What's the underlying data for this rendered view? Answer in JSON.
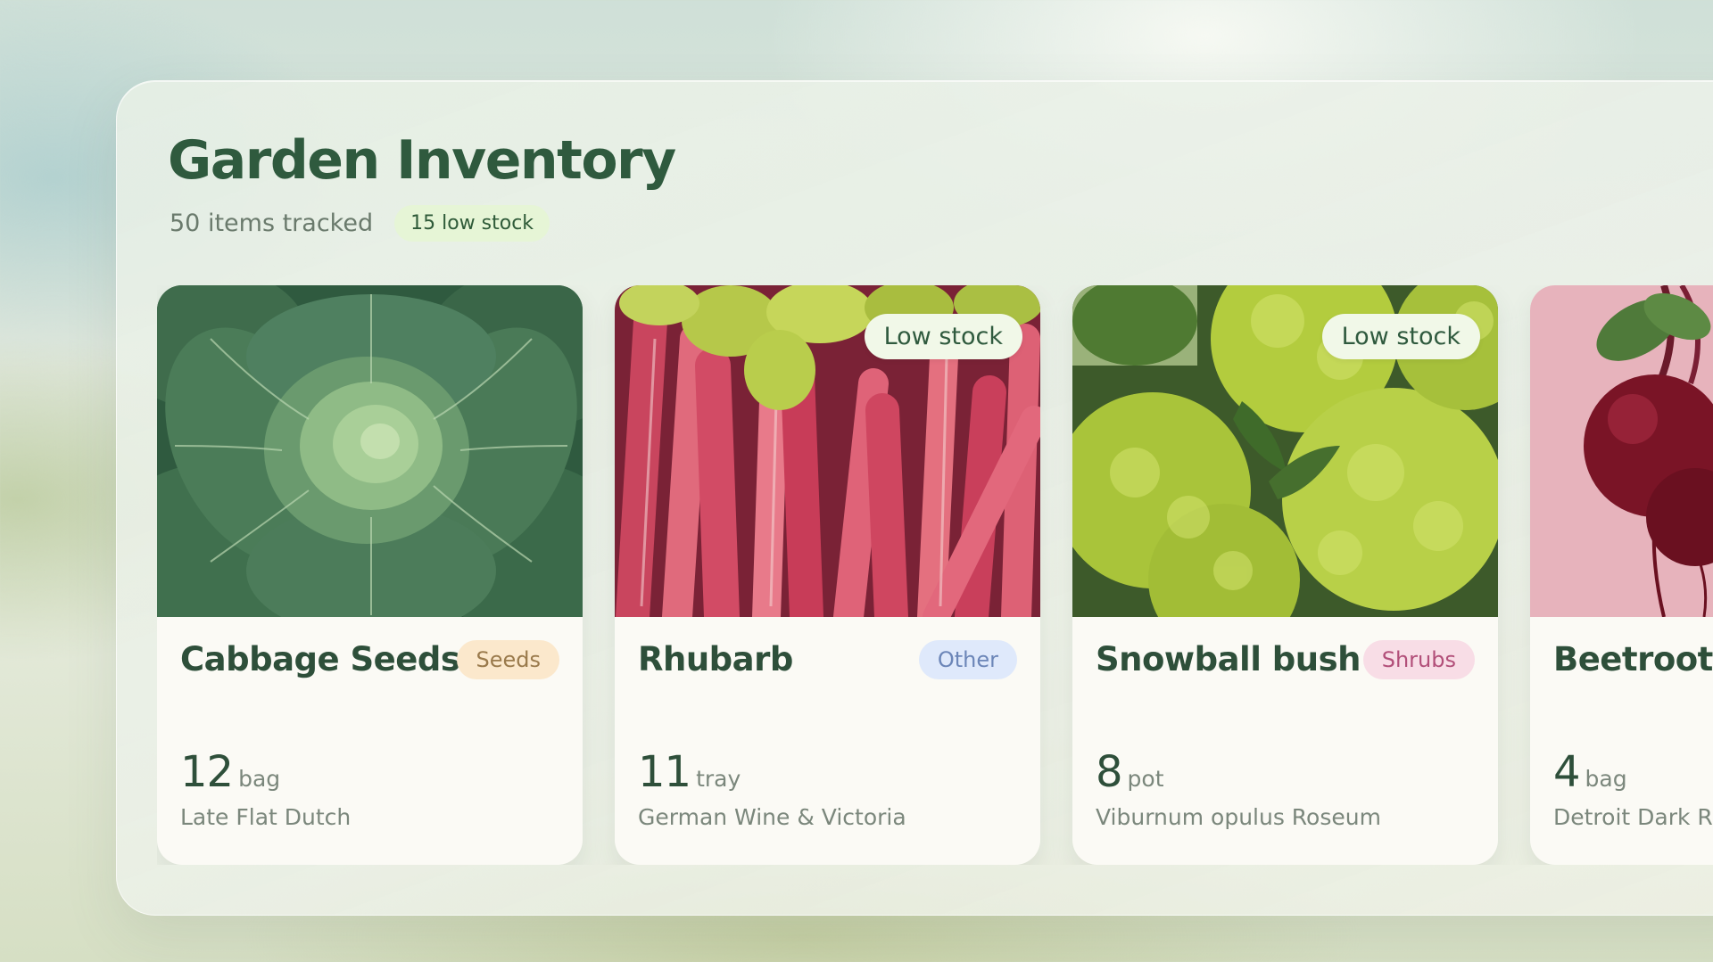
{
  "header": {
    "title": "Garden Inventory",
    "items_tracked": "50 items tracked",
    "low_stock_badge": "15 low stock"
  },
  "colors": {
    "title": "#2f5a3e",
    "low_badge_bg": "#e6f5d6",
    "card_bg": "#fbfaf5"
  },
  "cards": [
    {
      "name": "Cabbage Seeds",
      "category": "Seeds",
      "category_bg": "#fbe8cc",
      "category_fg": "#9a7a4c",
      "quantity": "12",
      "unit": "bag",
      "variety": "Late Flat Dutch",
      "stock_chip": "",
      "image": "cabbage-photo"
    },
    {
      "name": "Rhubarb",
      "category": "Other",
      "category_bg": "#dfe9fb",
      "category_fg": "#6c86b8",
      "quantity": "11",
      "unit": "tray",
      "variety": "German Wine & Victoria",
      "stock_chip": "Low stock",
      "image": "rhubarb-photo"
    },
    {
      "name": "Snowball bush",
      "category": "Shrubs",
      "category_bg": "#f8dde6",
      "category_fg": "#b24f79",
      "quantity": "8",
      "unit": "pot",
      "variety": "Viburnum opulus Roseum",
      "stock_chip": "Low stock",
      "image": "snowball-bush-photo"
    },
    {
      "name": "Beetroot",
      "category": "",
      "category_bg": "",
      "category_fg": "",
      "quantity": "4",
      "unit": "bag",
      "variety": "Detroit Dark Red",
      "stock_chip": "",
      "image": "beetroot-photo"
    }
  ]
}
